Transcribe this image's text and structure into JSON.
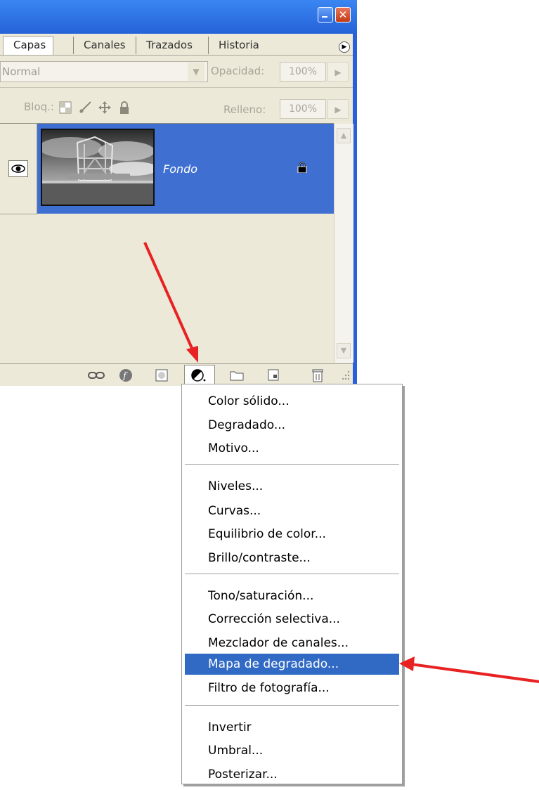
{
  "panel": {
    "tabs": [
      "Capas",
      "Canales",
      "Trazados",
      "Historia"
    ],
    "active_tab": "Capas",
    "blend_mode": "Normal",
    "opacity_label": "Opacidad:",
    "opacity_value": "100%",
    "lock_label": "Bloq.:",
    "fill_label": "Relleno:",
    "fill_value": "100%"
  },
  "layer": {
    "name": "Fondo",
    "visible": true,
    "locked": true
  },
  "menu": {
    "groups": [
      [
        "Color sólido...",
        "Degradado...",
        "Motivo..."
      ],
      [
        "Niveles...",
        "Curvas...",
        "Equilibrio de color...",
        "Brillo/contraste..."
      ],
      [
        "Tono/saturación...",
        "Corrección selectiva...",
        "Mezclador de canales...",
        "Mapa de degradado...",
        "Filtro de fotografía..."
      ],
      [
        "Invertir",
        "Umbral...",
        "Posterizar..."
      ]
    ],
    "highlighted": "Mapa de degradado..."
  },
  "colors": {
    "title_bar": "#2a5fd6",
    "panel_bg": "#ece9d8",
    "selection": "#316ac5",
    "annotation_arrow": "#e82222"
  },
  "icons": {
    "bottom_bar": [
      "link-icon",
      "layer-style-icon",
      "layer-mask-icon",
      "adjustment-layer-icon",
      "new-group-icon",
      "new-layer-icon",
      "trash-icon"
    ]
  }
}
